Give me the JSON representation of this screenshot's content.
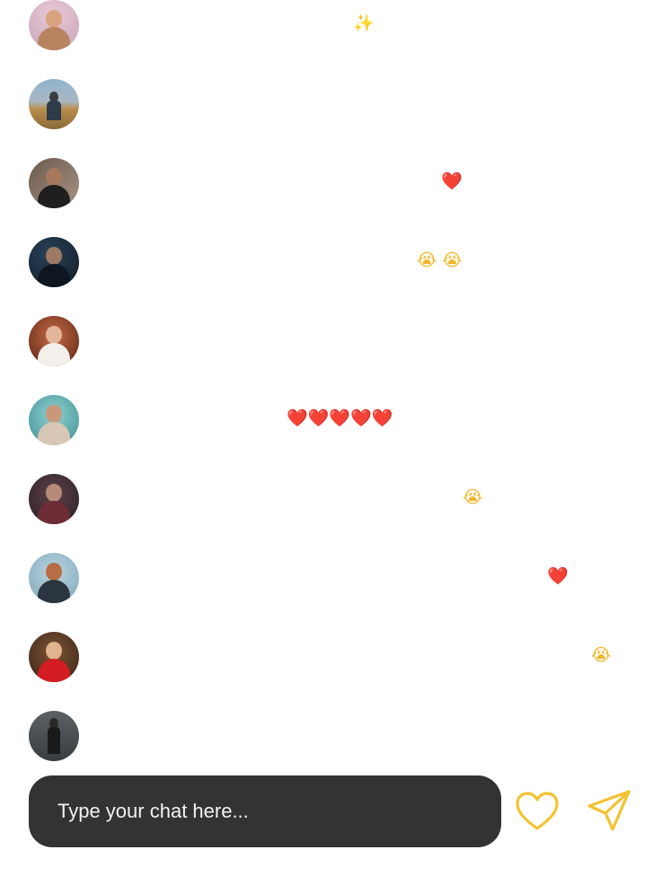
{
  "comments": [
    {
      "reaction": "✨"
    },
    {
      "reaction": ""
    },
    {
      "reaction": "❤️"
    },
    {
      "reaction": "😭 😭"
    },
    {
      "reaction": ""
    },
    {
      "reaction": "❤️❤️❤️❤️❤️"
    },
    {
      "reaction": "😭"
    },
    {
      "reaction": "❤️"
    },
    {
      "reaction": "😭"
    },
    {
      "reaction": ""
    }
  ],
  "chat": {
    "placeholder": "Type your chat here..."
  },
  "icons": {
    "like": "heart-outline-icon",
    "send": "paper-plane-icon"
  },
  "colors": {
    "accent": "#f5c230",
    "chat_bar": "#333333"
  }
}
